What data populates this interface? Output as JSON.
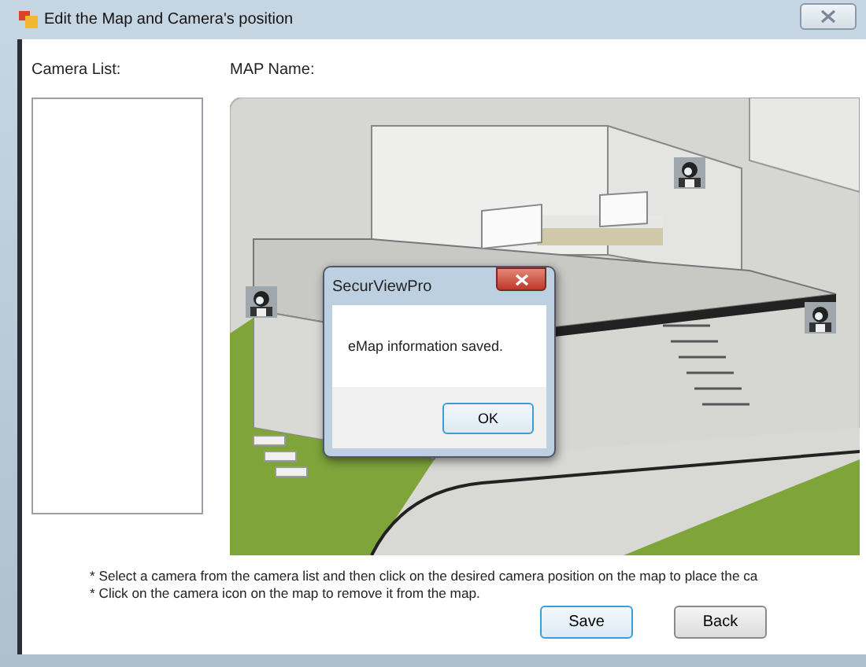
{
  "window": {
    "title": "Edit the Map and Camera's position"
  },
  "camera_list": {
    "label": "Camera List:"
  },
  "map": {
    "label": "MAP Name:"
  },
  "instructions": [
    "* Select a camera from the camera list and then click on the desired camera position on the map to place the ca",
    "* Click on the camera icon on the map to remove it from the map."
  ],
  "buttons": [
    {
      "label": "Save",
      "focused": true
    },
    {
      "label": "Back",
      "focused": false
    }
  ],
  "message_box": {
    "title": "SecurViewPro",
    "message": "eMap information saved.",
    "button": "OK"
  }
}
